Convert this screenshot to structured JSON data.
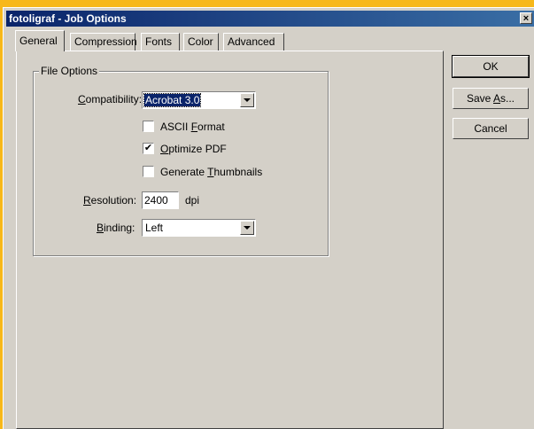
{
  "window": {
    "title": "fotoligraf - Job Options",
    "close_glyph": "×"
  },
  "tabs": [
    {
      "label": "General",
      "active": true
    },
    {
      "label": "Compression"
    },
    {
      "label": "Fonts"
    },
    {
      "label": "Color"
    },
    {
      "label": "Advanced"
    }
  ],
  "file_options": {
    "group_label": "File Options",
    "compatibility": {
      "label_prefix": "C",
      "label_rest": "ompatibility:",
      "value": "Acrobat 3.0"
    },
    "ascii_format": {
      "label_pre": "ASCII ",
      "label_u": "F",
      "label_post": "ormat",
      "checked": false
    },
    "optimize_pdf": {
      "label_u": "O",
      "label_post": "ptimize PDF",
      "checked": true
    },
    "generate_thumbnails": {
      "label_pre": "Generate ",
      "label_u": "T",
      "label_post": "humbnails",
      "checked": false
    },
    "resolution": {
      "label_u": "R",
      "label_post": "esolution:",
      "value": "2400",
      "unit": "dpi"
    },
    "binding": {
      "label_u": "B",
      "label_post": "inding:",
      "value": "Left"
    },
    "check_glyph": "✔"
  },
  "buttons": {
    "ok": "OK",
    "save_as_pre": "Save ",
    "save_as_u": "A",
    "save_as_post": "s...",
    "cancel": "Cancel"
  }
}
